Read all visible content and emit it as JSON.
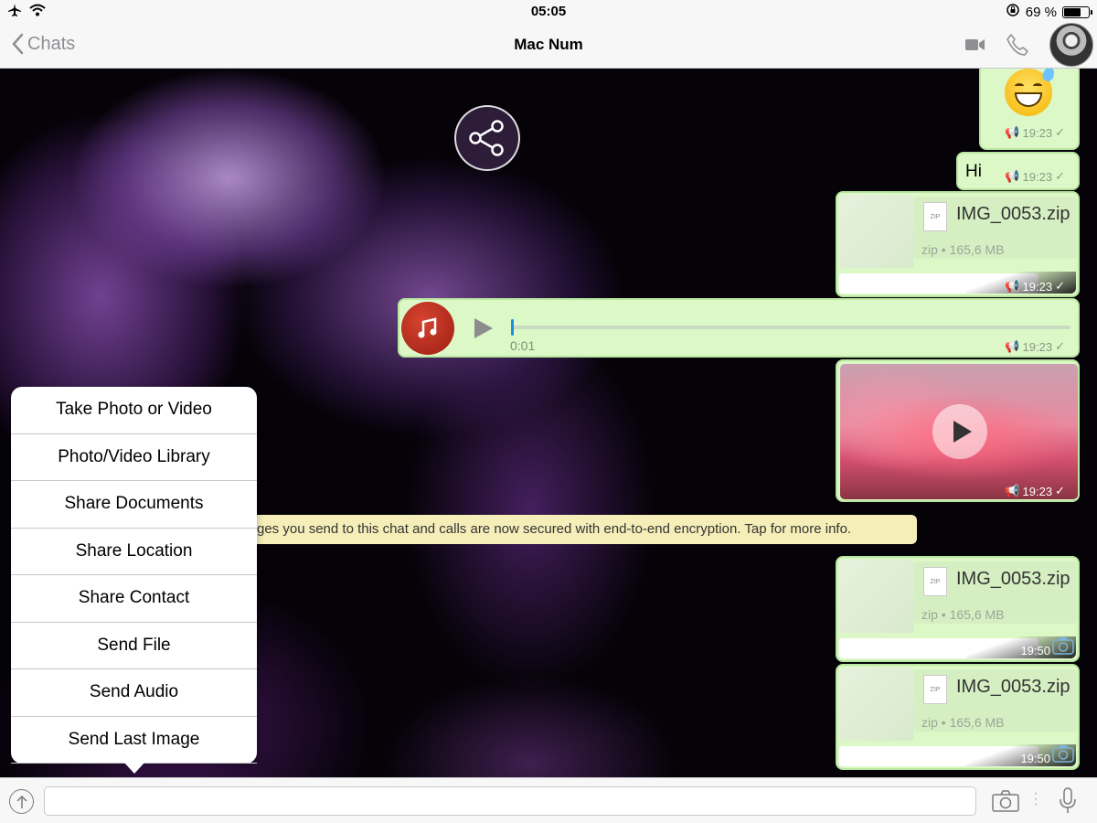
{
  "status_bar": {
    "time": "05:05",
    "battery_text": "69 %",
    "battery_level": 0.69
  },
  "nav": {
    "back_label": "Chats",
    "title": "Mac Num"
  },
  "messages": {
    "emoji": {
      "time": "19:23"
    },
    "hi": {
      "text": "Hi",
      "time": "19:23"
    },
    "file1": {
      "name": "IMG_0053.zip",
      "meta": "zip • 165,6 MB",
      "time": "19:23",
      "icon_label": "ZIP"
    },
    "audio": {
      "duration": "0:01",
      "time": "19:23",
      "progress": 0.0
    },
    "video": {
      "time": "19:23"
    },
    "file2": {
      "name": "IMG_0053.zip",
      "meta": "zip • 165,6 MB",
      "time": "19:50",
      "icon_label": "ZIP"
    },
    "file3": {
      "name": "IMG_0053.zip",
      "meta": "zip • 165,6 MB",
      "time": "19:50",
      "icon_label": "ZIP"
    }
  },
  "encryption_notice": "ges you send to this chat and calls are now secured with end-to-end encryption. Tap for more info.",
  "action_menu": {
    "items": [
      "Take Photo or Video",
      "Photo/Video Library",
      "Share Documents",
      "Share Location",
      "Share Contact",
      "Send File",
      "Send Audio",
      "Send Last Image"
    ]
  },
  "input": {
    "value": "",
    "placeholder": ""
  },
  "colors": {
    "bubble": "#dcf8c6",
    "notice": "#f6eeb9",
    "accent_blue": "#1e8ee0"
  }
}
